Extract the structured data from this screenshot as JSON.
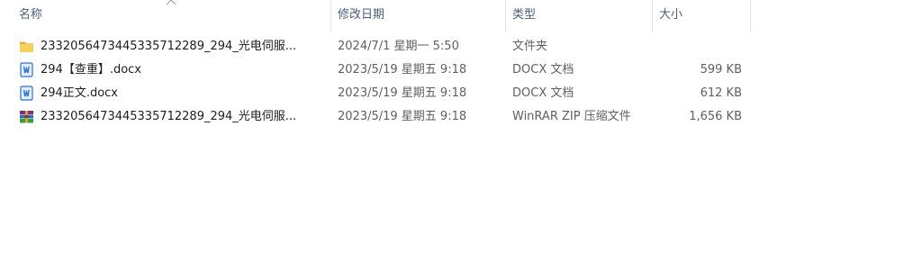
{
  "header": {
    "name_label": "名称",
    "date_label": "修改日期",
    "type_label": "类型",
    "size_label": "大小"
  },
  "files": [
    {
      "name": "2332056473445335712289_294_光电伺服...",
      "date": "2024/7/1 星期一 5:50",
      "type": "文件夹",
      "size": "",
      "icon": "folder-icon"
    },
    {
      "name": "294【查重】.docx",
      "date": "2023/5/19 星期五 9:18",
      "type": "DOCX 文档",
      "size": "599 KB",
      "icon": "word-doc-icon"
    },
    {
      "name": "294正文.docx",
      "date": "2023/5/19 星期五 9:18",
      "type": "DOCX 文档",
      "size": "612 KB",
      "icon": "word-doc-icon"
    },
    {
      "name": "2332056473445335712289_294_光电伺服...",
      "date": "2023/5/19 星期五 9:18",
      "type": "WinRAR ZIP 压缩文件",
      "size": "1,656 KB",
      "icon": "winrar-archive-icon"
    }
  ],
  "colors": {
    "header_text": "#4c607a",
    "folder": "#f0c54b",
    "word_blue": "#2b6fd6",
    "winrar": "#8b2a7c"
  }
}
